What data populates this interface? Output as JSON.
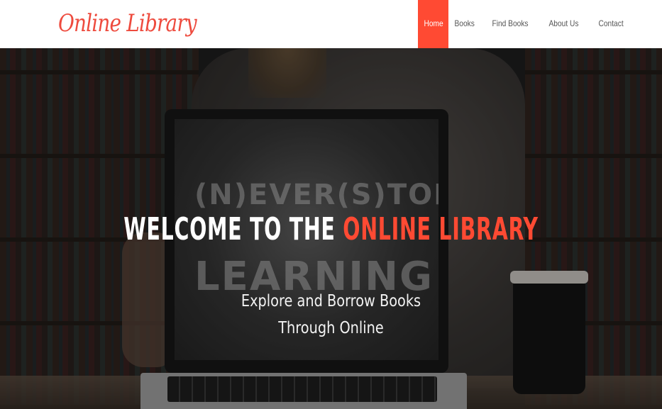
{
  "brand": {
    "name": "Online Library",
    "color": "#ee4b3e"
  },
  "nav": {
    "accent": "#ff4a33",
    "items": [
      {
        "label": "Home",
        "active": true
      },
      {
        "label": "Books",
        "active": false
      },
      {
        "label": "Find Books",
        "active": false
      },
      {
        "label": "About Us",
        "active": false
      },
      {
        "label": "Contact",
        "active": false
      }
    ]
  },
  "hero": {
    "title_prefix": "WELCOME TO THE",
    "title_highlight": "ONLINE LIBRARY",
    "highlight_color": "#ff4a33",
    "subtitle_line1": "Explore and Borrow Books",
    "subtitle_line2": "Through Online",
    "chalkboard_line1": "(N)EVER(S)TOP",
    "chalkboard_line2": "LEARNING"
  }
}
